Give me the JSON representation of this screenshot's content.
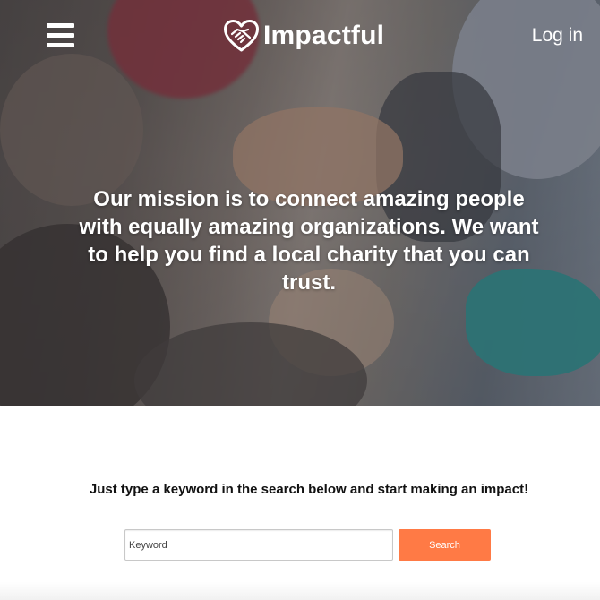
{
  "header": {
    "menu_icon": "hamburger-menu-icon",
    "logo_icon": "heart-handshake-icon",
    "brand_name": "Impactful",
    "login_label": "Log in"
  },
  "hero": {
    "mission_text": "Our mission is to connect amazing people with equally amazing organizations. We want to help you find a local charity that you can trust."
  },
  "search": {
    "prompt": "Just type a keyword in the search below and start making an impact!",
    "placeholder": "Keyword",
    "value": "",
    "button_label": "Search"
  },
  "colors": {
    "accent": "#ff7a45",
    "text_on_hero": "#ffffff",
    "prompt_text": "#111111"
  }
}
